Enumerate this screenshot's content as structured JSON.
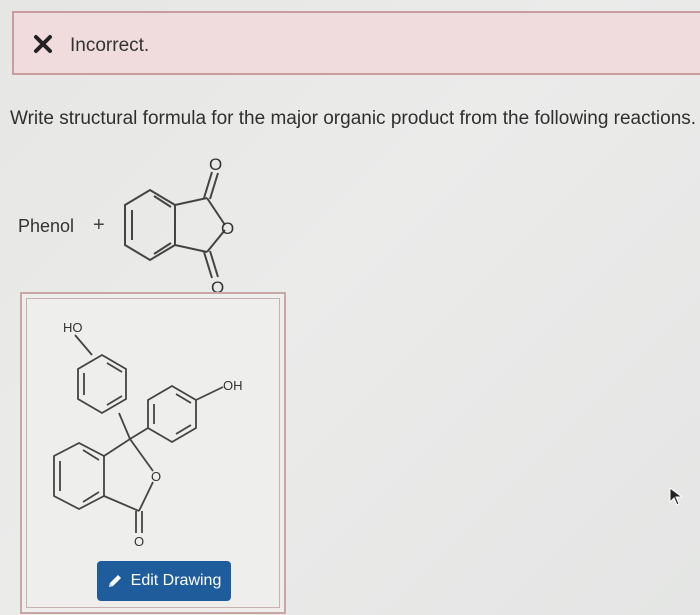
{
  "feedback": {
    "status_icon": "x-icon",
    "message": "Incorrect.",
    "background": "#f0dcdc",
    "border": "#c99d9f"
  },
  "question": {
    "prompt": "Write structural formula for the major organic product from the following reactions."
  },
  "reaction": {
    "reactant_name": "Phenol",
    "plus": "+",
    "anhydride_atom_top": "O",
    "anhydride_atom_ring": "O",
    "anhydride_atom_bottom": "O"
  },
  "answer": {
    "atom_ho": "HO",
    "atom_oh": "OH",
    "atom_ring_o": "O",
    "atom_carbonyl_o": "O",
    "edit_button_label": "Edit Drawing",
    "edit_button_icon": "pencil-icon",
    "button_color": "#1f5c9c"
  }
}
